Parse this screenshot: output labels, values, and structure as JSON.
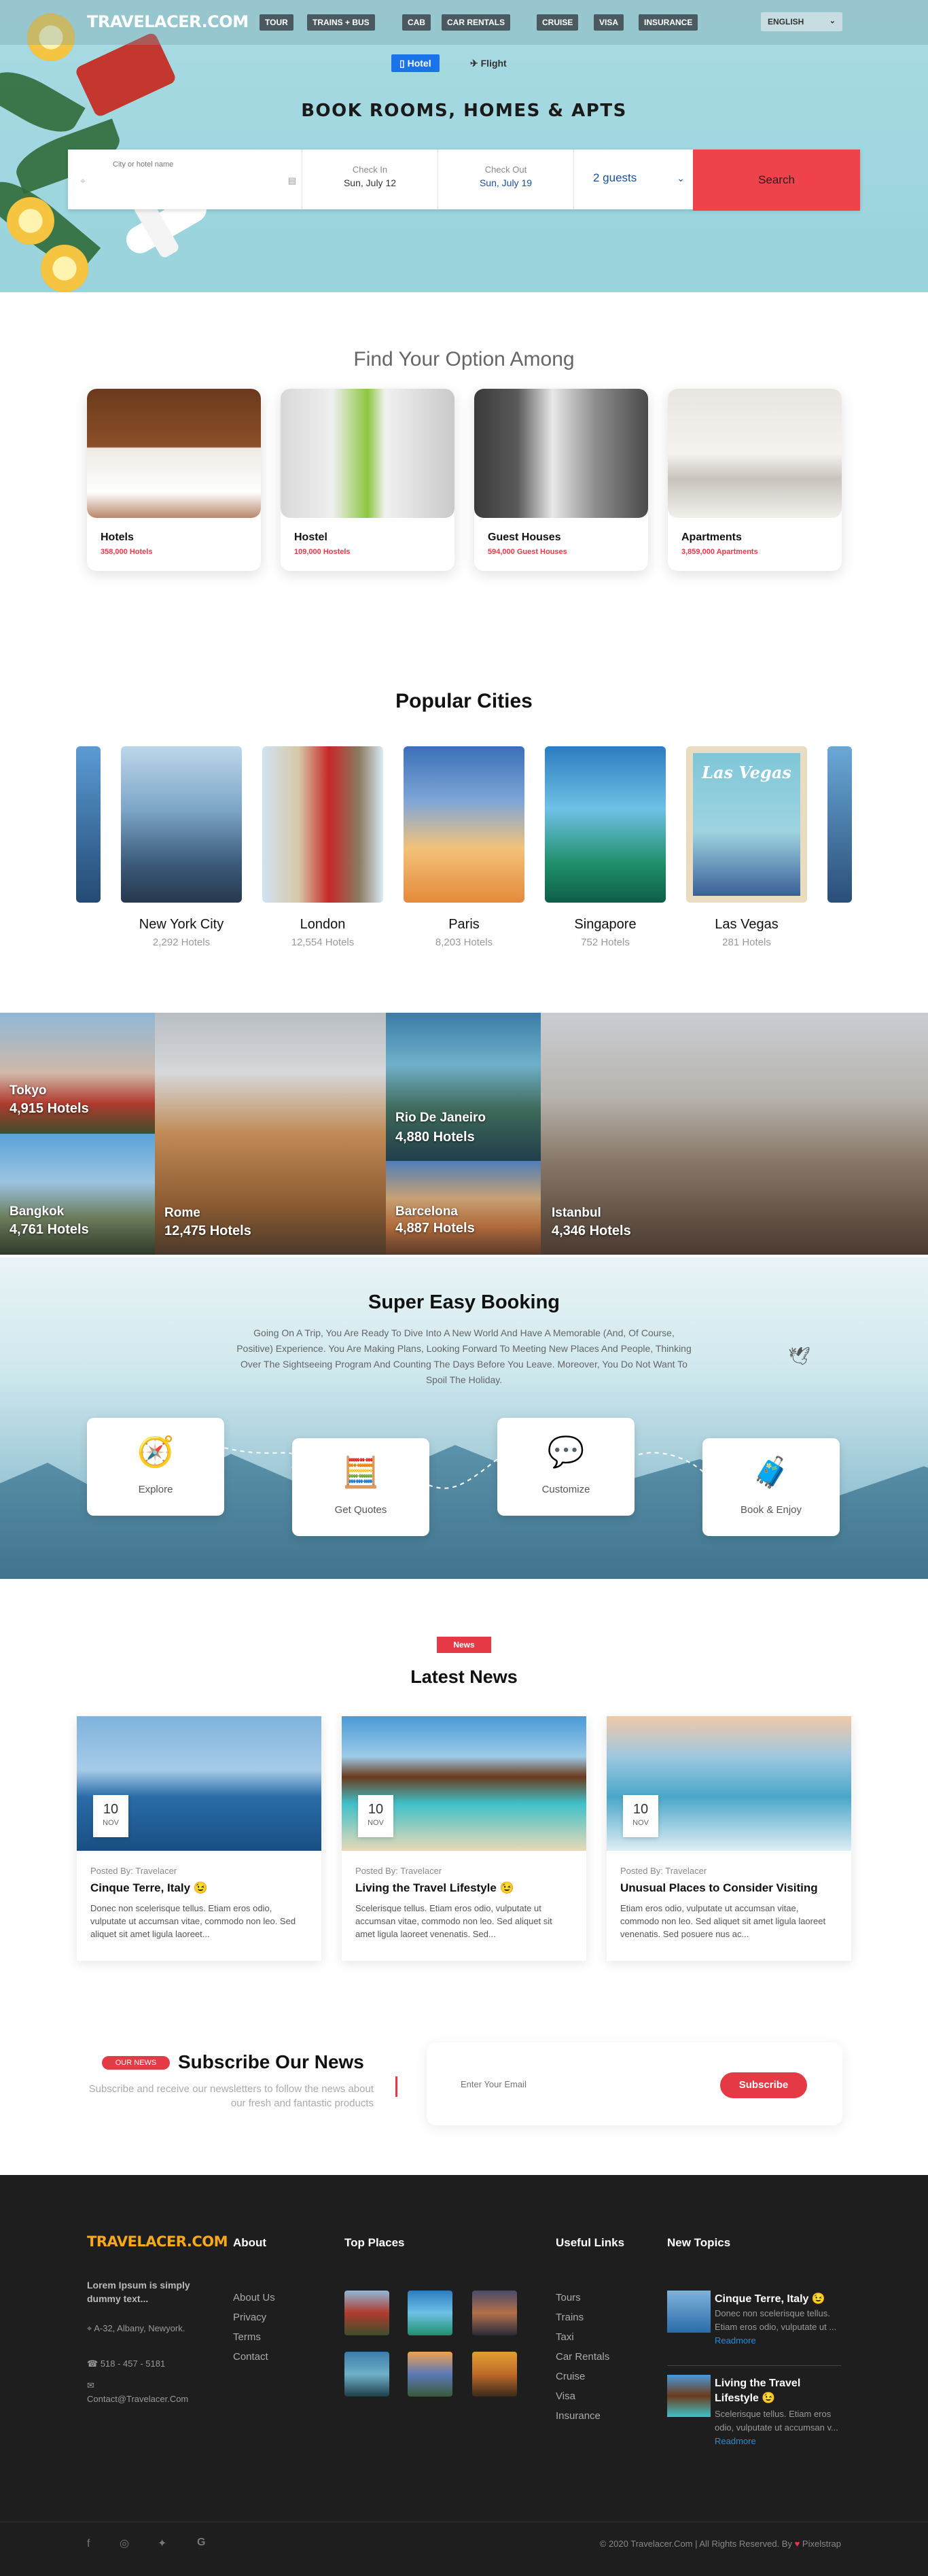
{
  "header": {
    "logo": "TRAVELACER.COM",
    "nav": [
      "TOUR",
      "TRAINS + BUS",
      "CAB",
      "CAR RENTALS",
      "CRUISE",
      "VISA",
      "INSURANCE"
    ],
    "language": "ENGLISH",
    "tabs": {
      "hotel": "Hotel",
      "flight": "Flight"
    }
  },
  "hero": {
    "title": "BOOK ROOMS, HOMES & APTS",
    "search": {
      "city_placeholder": "City or hotel name",
      "checkin_label": "Check In",
      "checkin_value": "Sun, July 12",
      "checkout_label": "Check Out",
      "checkout_value": "Sun, July 19",
      "guests": "2 guests",
      "button": "Search"
    }
  },
  "options": {
    "title": "Find Your Option Among",
    "items": [
      {
        "name": "Hotels",
        "count": "358,000 Hotels"
      },
      {
        "name": "Hostel",
        "count": "109,000 Hostels"
      },
      {
        "name": "Guest Houses",
        "count": "594,000 Guest Houses"
      },
      {
        "name": "Apartments",
        "count": "3,859,000 Apartments"
      }
    ]
  },
  "cities": {
    "title": "Popular Cities",
    "items": [
      {
        "name": "New York City",
        "count": "2,292 Hotels"
      },
      {
        "name": "London",
        "count": "12,554 Hotels"
      },
      {
        "name": "Paris",
        "count": "8,203 Hotels"
      },
      {
        "name": "Singapore",
        "count": "752 Hotels"
      },
      {
        "name": "Las Vegas",
        "count": "281 Hotels"
      }
    ],
    "poster_text": "Las Vegas"
  },
  "mosaic": [
    {
      "name": "Tokyo",
      "count": "4,915 Hotels"
    },
    {
      "name": "Bangkok",
      "count": "4,761 Hotels"
    },
    {
      "name": "Rome",
      "count": "12,475 Hotels"
    },
    {
      "name": "Rio De Janeiro",
      "count": "4,880 Hotels"
    },
    {
      "name": "Barcelona",
      "count": "4,887 Hotels"
    },
    {
      "name": "Istanbul",
      "count": "4,346 Hotels"
    }
  ],
  "booking": {
    "title": "Super Easy Booking",
    "text": "Going On A Trip, You Are Ready To Dive Into A New World And Have A Memorable (And, Of Course, Positive) Experience. You Are Making Plans, Looking Forward To Meeting New Places And People, Thinking Over The Sightseeing Program And Counting The Days Before You Leave. Moreover, You Do Not Want To Spoil The Holiday.",
    "steps": [
      "Explore",
      "Get Quotes",
      "Customize",
      "Book & Enjoy"
    ]
  },
  "news": {
    "badge": "News",
    "title": "Latest News",
    "items": [
      {
        "day": "10",
        "month": "NOV",
        "by": "Posted By: Travelacer",
        "title": "Cinque Terre, Italy 😉",
        "text": "Donec non scelerisque tellus. Etiam eros odio, vulputate ut accumsan vitae, commodo non leo. Sed aliquet sit amet ligula laoreet..."
      },
      {
        "day": "10",
        "month": "NOV",
        "by": "Posted By: Travelacer",
        "title": "Living the Travel Lifestyle 😉",
        "text": "Scelerisque tellus. Etiam eros odio, vulputate ut accumsan vitae, commodo non leo. Sed aliquet sit amet ligula laoreet venenatis. Sed..."
      },
      {
        "day": "10",
        "month": "NOV",
        "by": "Posted By: Travelacer",
        "title": "Unusual Places to Consider Visiting",
        "text": "Etiam eros odio, vulputate ut accumsan vitae, commodo non leo. Sed aliquet sit amet ligula laoreet venenatis. Sed posuere nus ac..."
      }
    ]
  },
  "subscribe": {
    "badge": "OUR NEWS",
    "title": "Subscribe Our News",
    "text": "Subscribe and receive our newsletters to follow the news about our fresh and fantastic products",
    "placeholder": "Enter Your Email",
    "button": "Subscribe"
  },
  "footer": {
    "logo": "TRAVELACER.COM",
    "tagline": "Lorem Ipsum is simply dummy text...",
    "address": "A-32, Albany, Newyork.",
    "phone": "518 - 457 - 5181",
    "email": "Contact@Travelacer.Com",
    "about_title": "About",
    "about_links": [
      "About Us",
      "Privacy",
      "Terms",
      "Contact"
    ],
    "places_title": "Top Places",
    "useful_title": "Useful Links",
    "useful_links": [
      "Tours",
      "Trains",
      "Taxi",
      "Car Rentals",
      "Cruise",
      "Visa",
      "Insurance"
    ],
    "topics_title": "New Topics",
    "topics": [
      {
        "title": "Cinque Terre, Italy 😉",
        "text": "Donec non scelerisque tellus. Etiam eros odio, vulputate ut ...",
        "more": "Readmore"
      },
      {
        "title": "Living the Travel Lifestyle 😉",
        "text": "Scelerisque tellus. Etiam eros odio, vulputate ut accumsan v...",
        "more": "Readmore"
      }
    ],
    "copyright": "© 2020 Travelacer.Com | All Rights Reserved. By",
    "brand": "Pixelstrap"
  }
}
